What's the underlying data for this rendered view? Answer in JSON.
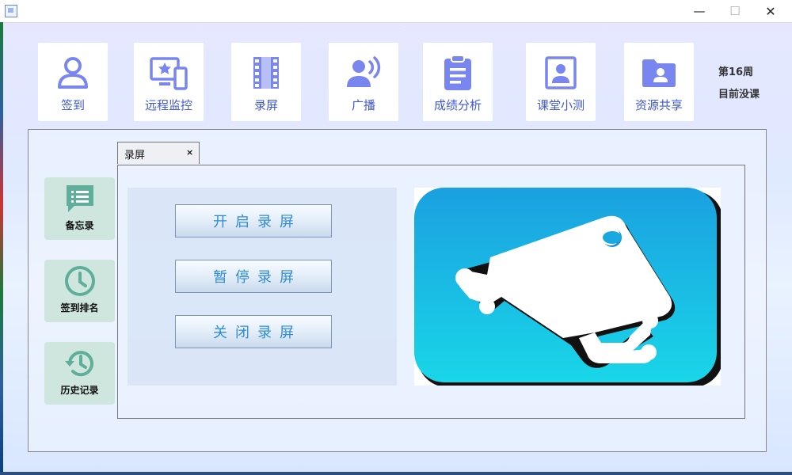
{
  "window": {
    "minimize_glyph": "—",
    "maximize_glyph": "☐",
    "close_glyph": "✕"
  },
  "nav": [
    {
      "label": "签到",
      "icon": "user-icon"
    },
    {
      "label": "远程监控",
      "icon": "monitor-phone-icon"
    },
    {
      "label": "录屏",
      "icon": "film-icon"
    },
    {
      "label": "广播",
      "icon": "broadcast-icon"
    },
    {
      "label": "成绩分析",
      "icon": "clipboard-icon"
    },
    {
      "label": "课堂小测",
      "icon": "portrait-icon"
    },
    {
      "label": "资源共享",
      "icon": "folder-user-icon"
    }
  ],
  "status": {
    "week": "第16周",
    "class_status": "目前没课"
  },
  "sidebar": [
    {
      "label": "备忘录",
      "icon": "chat-list-icon"
    },
    {
      "label": "签到排名",
      "icon": "clock-icon"
    },
    {
      "label": "历史记录",
      "icon": "history-icon"
    }
  ],
  "tab": {
    "label": "录屏",
    "close": "×"
  },
  "actions": {
    "start": "开启录屏",
    "pause": "暂停录屏",
    "stop": "关闭录屏"
  },
  "colors": {
    "nav_icon": "#7a86f0",
    "nav_text": "#3f58d6",
    "side_icon": "#5fae9a",
    "action_text": "#2f8cd8",
    "camera_bg_top": "#1aa0e0",
    "camera_bg_bottom": "#19d6e8"
  }
}
